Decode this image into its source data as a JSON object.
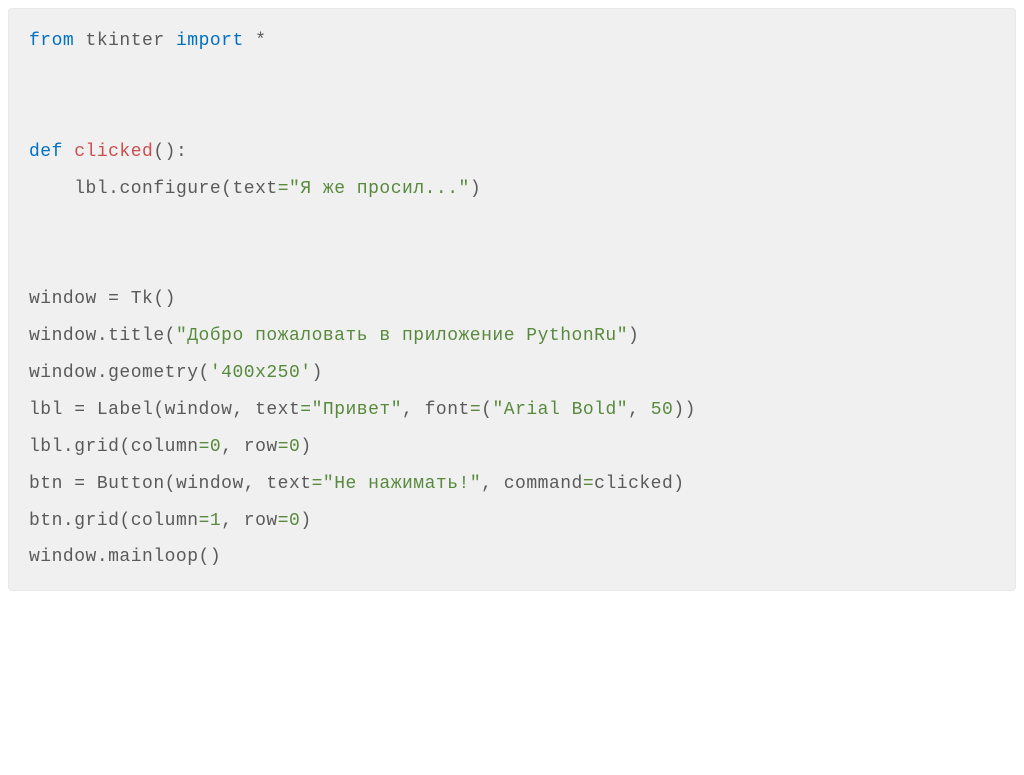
{
  "code": {
    "kw_from": "from",
    "mod_tkinter": "tkinter",
    "kw_import": "import",
    "star": "*",
    "kw_def": "def",
    "fn_clicked": "clicked",
    "paren_open": "(",
    "paren_close": ")",
    "colon": ":",
    "indent": "    ",
    "id_lbl": "lbl",
    "dot": ".",
    "m_configure": "configure",
    "kw_text": "text",
    "eq": "=",
    "str_asked": "\"Я же просил...\"",
    "id_window": "window",
    "assign": " = ",
    "cls_tk": "Tk",
    "m_title": "title",
    "str_title": "\"Добро пожаловать в приложение PythonRu\"",
    "m_geometry": "geometry",
    "str_geom": "'400x250'",
    "cls_label": "Label",
    "comma": ", ",
    "str_hello": "\"Привет\"",
    "kw_font": "font",
    "str_font": "\"Arial Bold\"",
    "num_50": "50",
    "m_grid": "grid",
    "kw_column": "column",
    "num_0": "0",
    "kw_row": "row",
    "id_btn": "btn",
    "cls_button": "Button",
    "str_btn": "\"Не нажимать!\"",
    "kw_command": "command",
    "id_clicked": "clicked",
    "num_1": "1",
    "m_mainloop": "mainloop"
  }
}
